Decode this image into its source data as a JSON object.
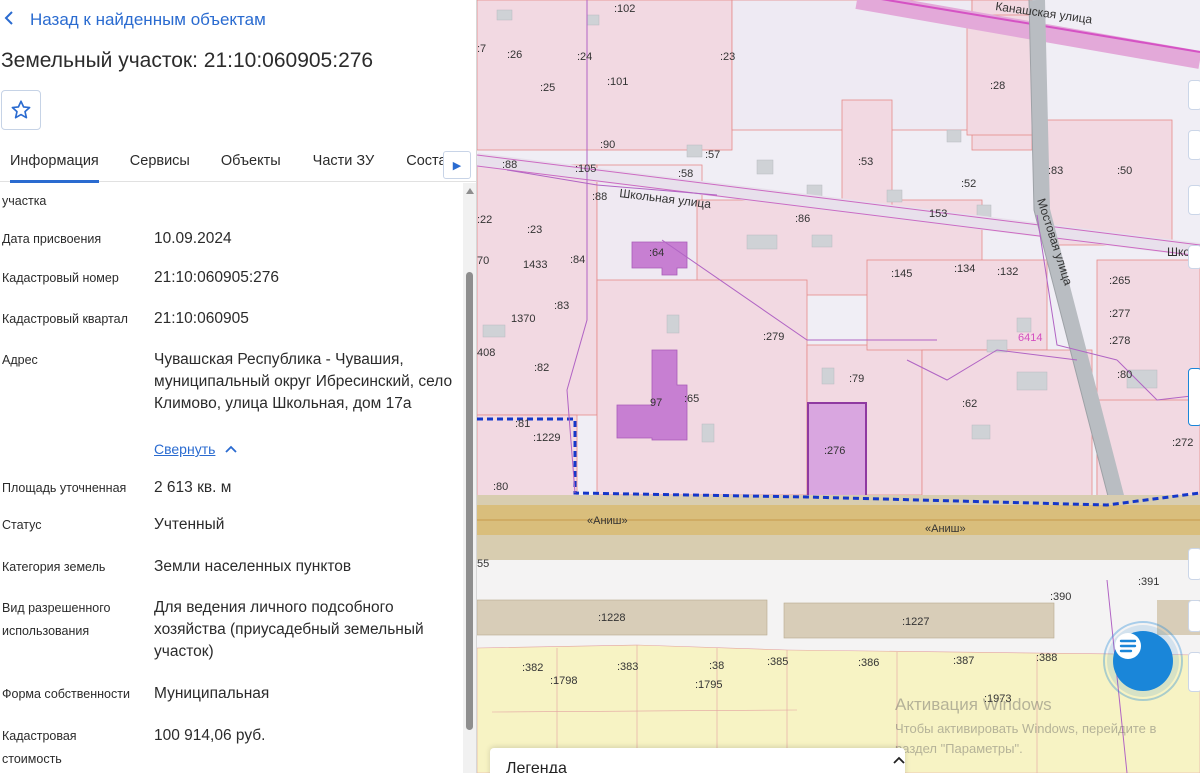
{
  "nav": {
    "back_label": "Назад к найденным объектам"
  },
  "page": {
    "title": "Земельный участок: 21:10:060905:276"
  },
  "tabs": [
    {
      "label": "Информация",
      "active": true
    },
    {
      "label": "Сервисы"
    },
    {
      "label": "Объекты"
    },
    {
      "label": "Части ЗУ"
    },
    {
      "label": "Состав"
    }
  ],
  "info": {
    "partial_label": "участка",
    "rows": [
      {
        "label": "Дата присвоения",
        "value": "10.09.2024"
      },
      {
        "label": "Кадастровый номер",
        "value": "21:10:060905:276"
      },
      {
        "label": "Кадастровый квартал",
        "value": "21:10:060905"
      },
      {
        "label": "Адрес",
        "value": "Чувашская Республика - Чувашия, муниципальный округ Ибресинский, село Климово, улица Школьная, дом 17а"
      },
      {
        "label": "Площадь уточненная",
        "value": "2 613 кв. м"
      },
      {
        "label": "Статус",
        "value": "Учтенный"
      },
      {
        "label": "Категория земель",
        "value": "Земли населенных пунктов"
      },
      {
        "label": "Вид разрешенного использования",
        "value": "Для ведения личного подсобного хозяйства (приусадебный земельный участок)"
      },
      {
        "label": "Форма собственности",
        "value": "Муниципальная"
      },
      {
        "label": "Кадастровая стоимость",
        "value": "100 914,06 руб."
      }
    ],
    "collapse_label": "Свернуть"
  },
  "map": {
    "streets": {
      "kanashskaya": "Канашская улица",
      "shkolnaya": "Школьная улица",
      "shkolnaya_cut": "Шко",
      "mostovaya": "Мостовая улица",
      "anish1": "«Аниш»",
      "anish2": "«Аниш»"
    },
    "parcels": [
      ":102",
      ":26",
      ":24",
      ":23",
      ":25",
      ":101",
      ":28",
      ":7",
      ":90",
      ":57",
      ":53",
      ":88",
      ":105",
      ":58",
      ":52",
      ":83",
      ":50",
      ":88",
      "153",
      ":86",
      ":22",
      ":23",
      ":64",
      ":145",
      ":134",
      ":132",
      ":265",
      "70",
      "1433",
      ":84",
      ":277",
      "1370",
      ":83",
      ":279",
      "6414",
      ":278",
      "408",
      ":82",
      ":79",
      ":80",
      ":65",
      "97",
      ":62",
      ":81",
      ":1229",
      ":276",
      ":272",
      ":80",
      "55",
      ":391",
      ":390",
      ":1228",
      ":1227",
      ":382",
      ":383",
      ":38",
      ":385",
      ":386",
      ":387",
      ":388",
      ":1798",
      ":1795",
      ":1973"
    ],
    "legend_label": "Легенда",
    "colors": {
      "parcel_fill": "#f2d9e2",
      "parcel_line": "#e58a8a",
      "selected": "#c77fd2",
      "street": "#d8d8d8",
      "road": "#d9be7c",
      "yellow_zone": "#f7f3c4"
    }
  },
  "watermark": {
    "line1": "Активация Windows",
    "line2": "Чтобы активировать Windows, перейдите в",
    "line3": "раздел \"Параметры\"."
  }
}
